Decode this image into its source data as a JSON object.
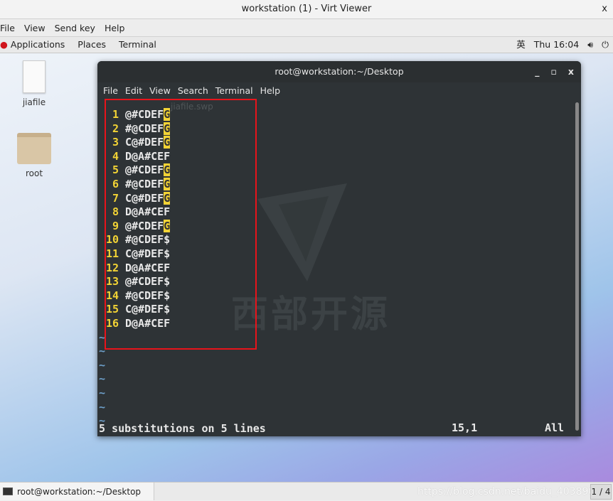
{
  "window": {
    "title": "workstation (1) - Virt Viewer",
    "close": "x"
  },
  "viewer_menu": [
    "File",
    "View",
    "Send key",
    "Help"
  ],
  "top_bar": {
    "left": [
      "Applications",
      "Places",
      "Terminal"
    ],
    "input_method": "英",
    "clock": "Thu 16:04",
    "icons": [
      "volume-icon",
      "power-icon"
    ]
  },
  "desktop_icons": [
    {
      "label": "jiafile",
      "icon": "file-icon"
    },
    {
      "label": "root",
      "icon": "home-folder-icon"
    }
  ],
  "terminal": {
    "title": "root@workstation:~/Desktop",
    "controls": [
      "_",
      "▫",
      "x"
    ],
    "menu": [
      "File",
      "Edit",
      "View",
      "Search",
      "Terminal",
      "Help"
    ],
    "ghost_text": "jiafile.swp",
    "lines": [
      {
        "n": "1",
        "text": "@#CDEF",
        "hl": "G"
      },
      {
        "n": "2",
        "text": "#@CDEF",
        "hl": "G"
      },
      {
        "n": "3",
        "text": "C@#DEF",
        "hl": "G"
      },
      {
        "n": "4",
        "text": "D@A#CEF",
        "hl": ""
      },
      {
        "n": "5",
        "text": "@#CDEF",
        "hl": "G"
      },
      {
        "n": "6",
        "text": "#@CDEF",
        "hl": "G"
      },
      {
        "n": "7",
        "text": "C@#DEF",
        "hl": "G"
      },
      {
        "n": "8",
        "text": "D@A#CEF",
        "hl": ""
      },
      {
        "n": "9",
        "text": "@#CDEF",
        "hl": "G"
      },
      {
        "n": "10",
        "text": "#@CDEF$",
        "hl": ""
      },
      {
        "n": "11",
        "text": "C@#DEF$",
        "hl": ""
      },
      {
        "n": "12",
        "text": "D@A#CEF",
        "hl": ""
      },
      {
        "n": "13",
        "text": "@#CDEF$",
        "hl": ""
      },
      {
        "n": "14",
        "text": "#@CDEF$",
        "hl": ""
      },
      {
        "n": "15",
        "text": "C@#DEF$",
        "hl": ""
      },
      {
        "n": "16",
        "text": "D@A#CEF",
        "hl": ""
      }
    ],
    "tilde_count": 7,
    "status": "5 substitutions on 5 lines",
    "position": "15,1",
    "scroll_pos": "All",
    "highlight_color": "#f2d335"
  },
  "watermark": "西部开源",
  "taskbar": {
    "task": "root@workstation:~/Desktop",
    "url_watermark": "https://blog.csdn.net/baidu_40389082",
    "pager": "1 / 4"
  }
}
